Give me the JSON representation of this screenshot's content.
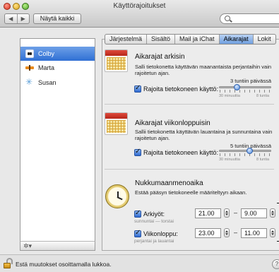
{
  "window": {
    "title": "Käyttörajoitukset",
    "show_all": "Näytä kaikki",
    "back_glyph": "◀",
    "forward_glyph": "▶"
  },
  "users": [
    {
      "name": "Colby",
      "icon": "robot-face-icon",
      "selected": true
    },
    {
      "name": "Marta",
      "icon": "butterfly-icon",
      "selected": false
    },
    {
      "name": "Susan",
      "icon": "snowflake-icon",
      "selected": false
    }
  ],
  "user_list_menu": "✲▾",
  "tabs": [
    {
      "label": "Järjestelmä",
      "active": false
    },
    {
      "label": "Sisältö",
      "active": false
    },
    {
      "label": "Mail ja iChat",
      "active": false
    },
    {
      "label": "Aikarajat",
      "active": true
    },
    {
      "label": "Lokit",
      "active": false
    }
  ],
  "weekday": {
    "title": "Aikarajat arkisin",
    "description": "Salli tietokonetta käyttävän maanantaista perjantaihin vain rajoitetun ajan.",
    "checkbox_label": "Rajoita tietokoneen käyttö:",
    "checked": true,
    "value_label": "3 tuntiin päivässä",
    "min_label": "30 minuuttia",
    "max_label": "8 tuntia",
    "slider_fraction": 0.35
  },
  "weekend": {
    "title": "Aikarajat viikonloppuisin",
    "description": "Sallii tietokonetta käyttävän lauantaina ja sunnuntaina vain rajoitetun ajan.",
    "checkbox_label": "Rajoita tietokoneen käyttö:",
    "checked": true,
    "value_label": "5 tuntiin päivässä",
    "min_label": "30 minuuttia",
    "max_label": "8 tuntia",
    "slider_fraction": 0.6
  },
  "bedtime": {
    "title": "Nukkumaanmenoaika",
    "description": "Estää pääsyn tietokoneelle määriteltyyn aikaan.",
    "weekdays": {
      "label": "Arkiyöt:",
      "sublabel": "sunnuntai — torstai",
      "from": "21.00",
      "to": "9.00",
      "checked": true
    },
    "weekend": {
      "label": "Viikonloppu:",
      "sublabel": "perjantai ja lauantai",
      "from": "23.00",
      "to": "11.00",
      "checked": true
    },
    "dash": "–"
  },
  "bottom": {
    "lock_text": "Estä muutokset osoittamalla lukkoa.",
    "help": "?"
  }
}
